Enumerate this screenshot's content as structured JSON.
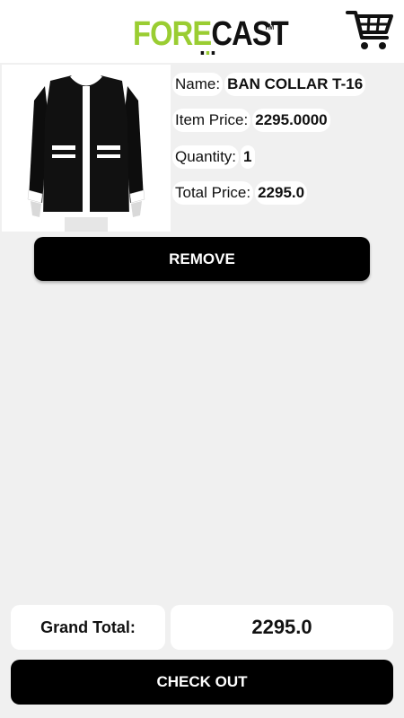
{
  "header": {
    "logo_part1": "FORE",
    "logo_part2": "CAST",
    "logo_tm": "TM",
    "brand_green": "#9acd32",
    "cart_icon": "shopping-cart-icon"
  },
  "cart_item": {
    "name_label": "Name:",
    "name_value": "BAN COLLAR T-16",
    "item_price_label": "Item Price:",
    "item_price_value": "2295.0000",
    "quantity_label": "Quantity:",
    "quantity_value": "1",
    "total_price_label": "Total Price:",
    "total_price_value": "2295.0",
    "remove_label": "REMOVE"
  },
  "footer": {
    "grand_total_label": "Grand Total:",
    "grand_total_value": "2295.0",
    "checkout_label": "CHECK OUT"
  }
}
